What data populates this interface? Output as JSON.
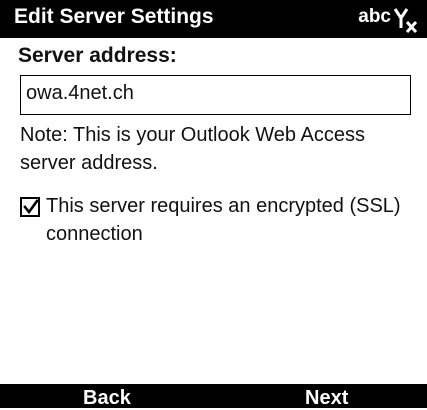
{
  "titlebar": {
    "title": "Edit Server Settings",
    "input_mode": "abc",
    "signal_icon": "signal-off-icon"
  },
  "form": {
    "server_label": "Server address:",
    "server_value": "owa.4net.ch",
    "note": "Note: This is your Outlook Web Access server address.",
    "ssl_label": "This server requires an encrypted (SSL) connection",
    "ssl_checked": true
  },
  "softkeys": {
    "left": "Back",
    "right": "Next"
  },
  "colors": {
    "bar": "#000000",
    "bar_text": "#ffffff",
    "background": "#ffffff"
  }
}
